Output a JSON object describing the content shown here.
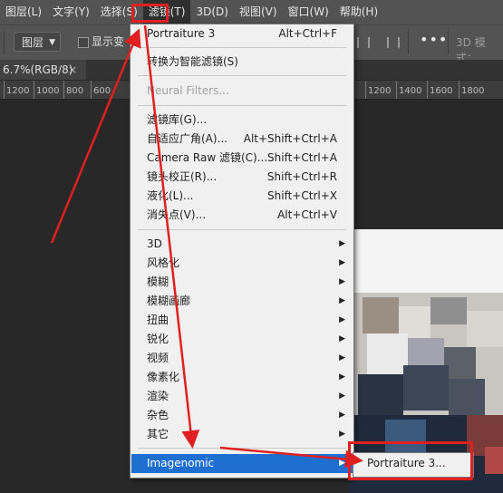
{
  "menubar": {
    "items": [
      "图层(L)",
      "文字(Y)",
      "选择(S)",
      "滤镜(T)",
      "3D(D)",
      "视图(V)",
      "窗口(W)",
      "帮助(H)"
    ],
    "active_index": 3
  },
  "options": {
    "layer_select": "图层",
    "show_transform": "显示变",
    "more": "•••",
    "mode_3d": "3D 模式："
  },
  "document_tab": {
    "title": "6.7%(RGB/8)",
    "close": "×"
  },
  "ruler": {
    "ticks": [
      "1200",
      "1000",
      "800",
      "600",
      "1200",
      "1400",
      "1600",
      "1800"
    ]
  },
  "filter_menu": {
    "last_filter": {
      "label": "Portraiture 3",
      "shortcut": "Alt+Ctrl+F"
    },
    "convert_smart": "转换为智能滤镜(S)",
    "neural": "Neural Filters...",
    "items": [
      {
        "label": "滤镜库(G)...",
        "shortcut": ""
      },
      {
        "label": "自适应广角(A)...",
        "shortcut": "Alt+Shift+Ctrl+A"
      },
      {
        "label": "Camera Raw 滤镜(C)...",
        "shortcut": "Shift+Ctrl+A"
      },
      {
        "label": "镜头校正(R)...",
        "shortcut": "Shift+Ctrl+R"
      },
      {
        "label": "液化(L)...",
        "shortcut": "Shift+Ctrl+X"
      },
      {
        "label": "消失点(V)...",
        "shortcut": "Alt+Ctrl+V"
      }
    ],
    "groups": [
      "3D",
      "风格化",
      "模糊",
      "模糊画廊",
      "扭曲",
      "锐化",
      "视频",
      "像素化",
      "渲染",
      "杂色",
      "其它"
    ],
    "plugin": "Imagenomic"
  },
  "submenu": {
    "item": "Portraiture 3..."
  },
  "colors": {
    "highlight": "#1e6fd0",
    "annotation": "#e02020",
    "menubar": "#535353"
  }
}
